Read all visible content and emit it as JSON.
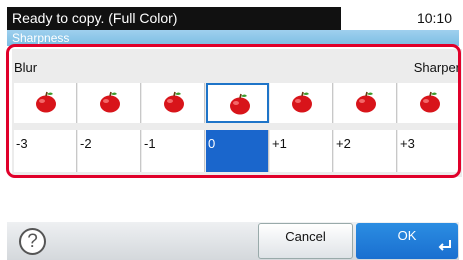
{
  "status": {
    "message": "Ready to copy. (Full Color)",
    "time": "10:10"
  },
  "title": "Sharpness",
  "labels": {
    "left": "Blur",
    "right": "Sharper"
  },
  "levels": [
    {
      "value": "-3",
      "selected": false
    },
    {
      "value": "-2",
      "selected": false
    },
    {
      "value": "-1",
      "selected": false
    },
    {
      "value": "0",
      "selected": true
    },
    {
      "value": "+1",
      "selected": false
    },
    {
      "value": "+2",
      "selected": false
    },
    {
      "value": "+3",
      "selected": false
    }
  ],
  "footer": {
    "help_symbol": "?",
    "cancel_label": "Cancel",
    "ok_label": "OK"
  },
  "colors": {
    "accent": "#1a66cc",
    "highlight_frame": "#e0002a",
    "apple": "#d8141a"
  },
  "icons": {
    "level_image": "apple-icon",
    "help": "help-icon",
    "enter": "enter-key-icon"
  }
}
